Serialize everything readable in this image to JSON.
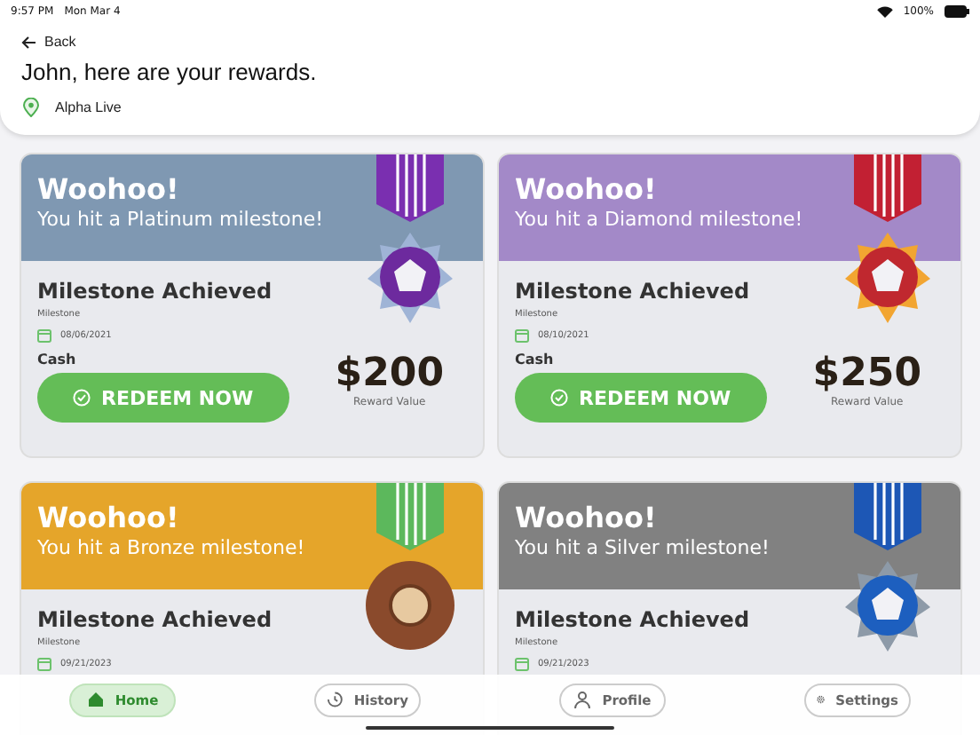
{
  "status_bar": {
    "time": "9:57 PM",
    "date": "Mon Mar 4",
    "battery": "100%"
  },
  "header": {
    "back": "Back",
    "title": "John, here are your rewards.",
    "location": "Alpha Live"
  },
  "cards": [
    {
      "kind": "platinum",
      "color": "#7f98b2",
      "headline": "Woohoo!",
      "message": "You hit a Platinum milestone!",
      "title": "Milestone Achieved",
      "type": "Milestone",
      "date": "08/06/2021",
      "reward_type": "Cash",
      "amount": "$200",
      "amount_label": "Reward Value",
      "button": "REDEEM NOW"
    },
    {
      "kind": "diamond",
      "color": "#a389c8",
      "headline": "Woohoo!",
      "message": "You hit a Diamond milestone!",
      "title": "Milestone Achieved",
      "type": "Milestone",
      "date": "08/10/2021",
      "reward_type": "Cash",
      "amount": "$250",
      "amount_label": "Reward Value",
      "button": "REDEEM NOW"
    },
    {
      "kind": "bronze",
      "color": "#e5a52a",
      "headline": "Woohoo!",
      "message": "You hit a Bronze milestone!",
      "title": "Milestone Achieved",
      "type": "Milestone",
      "date": "09/21/2023"
    },
    {
      "kind": "silver",
      "color": "#818181",
      "headline": "Woohoo!",
      "message": "You hit a Silver milestone!",
      "title": "Milestone Achieved",
      "type": "Milestone",
      "date": "09/21/2023"
    }
  ],
  "tabs": [
    {
      "label": "Home",
      "selected": true
    },
    {
      "label": "History",
      "selected": false
    },
    {
      "label": "Profile",
      "selected": false
    },
    {
      "label": "Settings",
      "selected": false
    }
  ]
}
